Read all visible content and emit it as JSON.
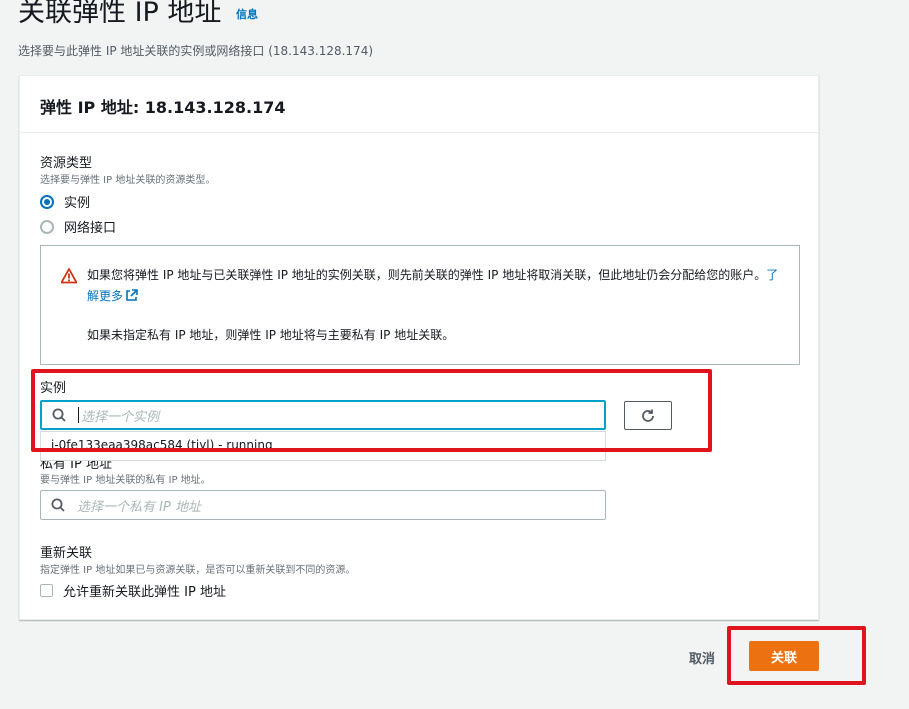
{
  "header": {
    "title": "关联弹性 IP 地址",
    "info_link": "信息",
    "subtitle": "选择要与此弹性 IP 地址关联的实例或网络接口 (18.143.128.174)"
  },
  "panel": {
    "title": "弹性 IP 地址: 18.143.128.174"
  },
  "resource_type": {
    "label": "资源类型",
    "description": "选择要与弹性 IP 地址关联的资源类型。",
    "options": [
      {
        "label": "实例",
        "checked": true
      },
      {
        "label": "网络接口",
        "checked": false
      }
    ]
  },
  "alert": {
    "text": "如果您将弹性 IP 地址与已关联弹性 IP 地址的实例关联，则先前关联的弹性 IP 地址将取消关联，但此地址仍会分配给您的账户。",
    "learn_more": "了解更多",
    "text2": "如果未指定私有 IP 地址，则弹性 IP 地址将与主要私有 IP 地址关联。"
  },
  "instance": {
    "label": "实例",
    "placeholder": "选择一个实例",
    "option": "i-0fe133eaa398ac584 (tiyl) - running"
  },
  "private_ip": {
    "label": "私有 IP 地址",
    "description": "要与弹性 IP 地址关联的私有 IP 地址。",
    "placeholder": "选择一个私有 IP 地址"
  },
  "reassociation": {
    "label": "重新关联",
    "description": "指定弹性 IP 地址如果已与资源关联，是否可以重新关联到不同的资源。",
    "checkbox_label": "允许重新关联此弹性 IP 地址"
  },
  "footer": {
    "cancel": "取消",
    "submit": "关联"
  },
  "colors": {
    "primary": "#ec7211",
    "link": "#0073bb",
    "focus": "#00a1c9",
    "highlight": "#e0141e",
    "warning": "#d13212"
  }
}
